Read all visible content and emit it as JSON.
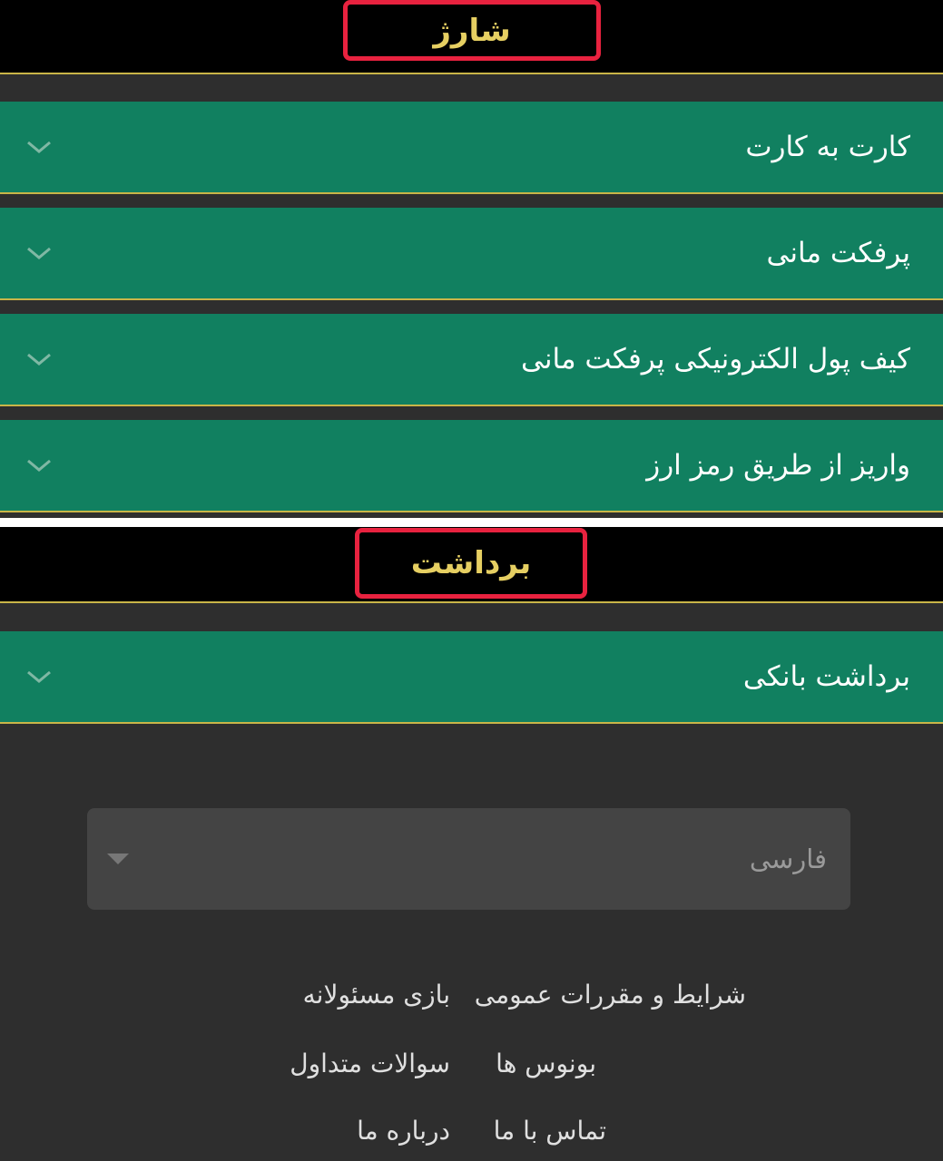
{
  "deposit": {
    "title": "شارژ",
    "items": [
      {
        "label": "کارت به کارت"
      },
      {
        "label": "پرفکت مانی"
      },
      {
        "label": "کیف پول الکترونیکی پرفکت مانی"
      },
      {
        "label": "واریز از طریق رمز ارز"
      }
    ]
  },
  "withdraw": {
    "title": "برداشت",
    "items": [
      {
        "label": "برداشت بانکی"
      }
    ]
  },
  "language": {
    "selected": "فارسی"
  },
  "footer": {
    "links": {
      "terms": "شرایط و مقررات عمومی",
      "responsible": "بازی مسئولانه",
      "bonuses": "بونوس ها",
      "faq": "سوالات متداول",
      "contact": "تماس با ما",
      "about": "درباره ما"
    }
  },
  "colors": {
    "accordion_bg": "#118060",
    "title_gold": "#e6cf62",
    "highlight_red": "#e8223f",
    "page_bg": "#2e2e2e"
  },
  "icons": {
    "accordion_toggle": "chevron-down-icon",
    "select_caret": "caret-down-icon"
  }
}
